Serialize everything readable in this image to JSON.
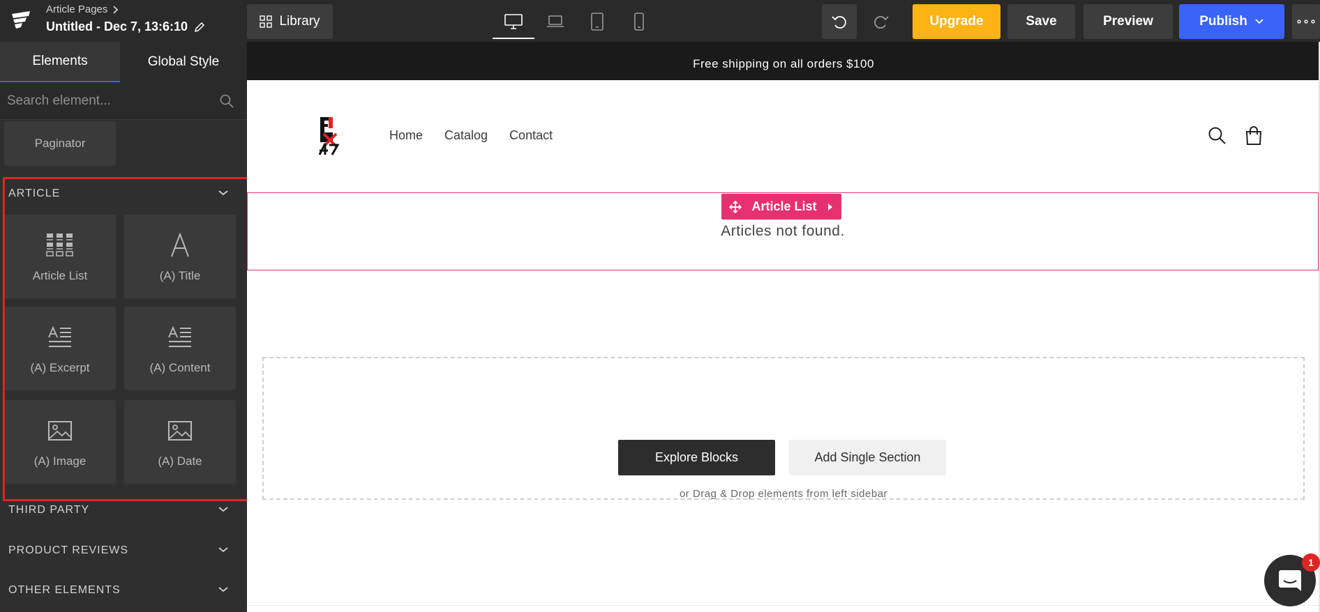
{
  "header": {
    "breadcrumb": "Article Pages",
    "page_name": "Untitled - Dec 7, 13:6:10",
    "library_label": "Library",
    "devices": [
      "desktop-icon",
      "laptop-icon",
      "tablet-icon",
      "mobile-icon"
    ],
    "upgrade_label": "Upgrade",
    "save_label": "Save",
    "preview_label": "Preview",
    "publish_label": "Publish",
    "more_label": "∘∘∘"
  },
  "sidebar": {
    "tabs": [
      {
        "label": "Elements"
      },
      {
        "label": "Global Style"
      }
    ],
    "search_placeholder": "Search element...",
    "paginator_label": "Paginator",
    "article_section": {
      "title": "ARTICLE",
      "tiles": [
        {
          "label": "Article List",
          "icon": "grid-icon"
        },
        {
          "label": "(A) Title",
          "icon": "letter-a-icon"
        },
        {
          "label": "(A) Excerpt",
          "icon": "text-lines-icon"
        },
        {
          "label": "(A) Content",
          "icon": "text-lines-icon"
        },
        {
          "label": "(A) Image",
          "icon": "image-icon"
        },
        {
          "label": "(A) Date",
          "icon": "image-icon"
        }
      ]
    },
    "collapsed_sections": [
      {
        "title": "THIRD PARTY"
      },
      {
        "title": "PRODUCT REVIEWS"
      },
      {
        "title": "OTHER ELEMENTS"
      }
    ]
  },
  "canvas": {
    "announcement": "Free shipping on all orders $100",
    "nav_items": [
      {
        "label": "Home"
      },
      {
        "label": "Catalog"
      },
      {
        "label": "Contact"
      }
    ],
    "article_list_tag": "Article List",
    "articles_empty": "Articles not found.",
    "explore_label": "Explore Blocks",
    "add_section_label": "Add Single Section",
    "drag_hint": "or Drag & Drop elements from left sidebar"
  },
  "chat_badge": "1",
  "colors": {
    "topbar": "#2a2a2a",
    "upgrade": "#fcb316",
    "publish": "#3a63f7",
    "selection": "#e6306f",
    "highlight": "#e12424"
  }
}
